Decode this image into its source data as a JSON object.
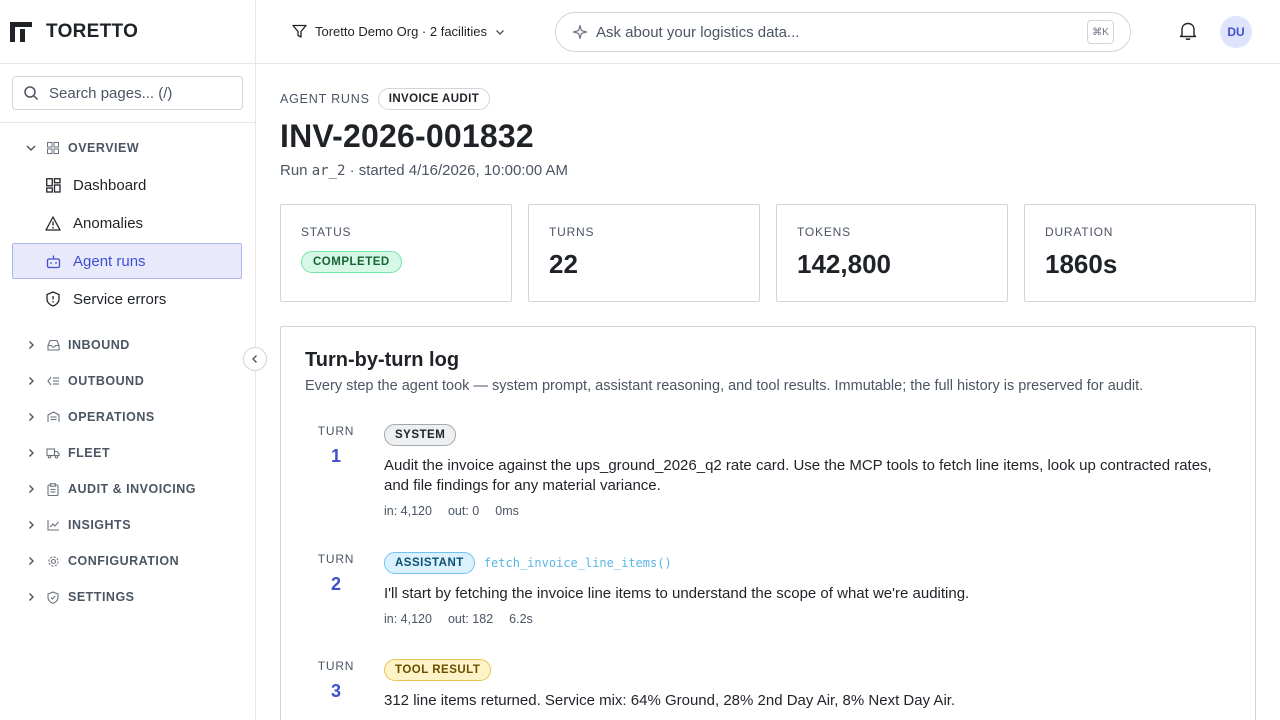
{
  "brand": {
    "name": "TORETTO"
  },
  "sidebar": {
    "search_placeholder": "Search pages...  (/)",
    "overview_group": "OVERVIEW",
    "overview_items": [
      {
        "label": "Dashboard",
        "icon": "dashboard-icon"
      },
      {
        "label": "Anomalies",
        "icon": "warning-triangle-icon"
      },
      {
        "label": "Agent runs",
        "icon": "robot-icon",
        "active": true
      },
      {
        "label": "Service errors",
        "icon": "shield-alert-icon"
      }
    ],
    "groups": [
      {
        "label": "INBOUND",
        "icon": "inbox-icon"
      },
      {
        "label": "OUTBOUND",
        "icon": "outbound-icon"
      },
      {
        "label": "OPERATIONS",
        "icon": "warehouse-icon"
      },
      {
        "label": "FLEET",
        "icon": "truck-icon"
      },
      {
        "label": "AUDIT & INVOICING",
        "icon": "clipboard-icon"
      },
      {
        "label": "INSIGHTS",
        "icon": "line-chart-icon"
      },
      {
        "label": "CONFIGURATION",
        "icon": "gear-icon"
      },
      {
        "label": "SETTINGS",
        "icon": "shield-check-icon"
      }
    ]
  },
  "topbar": {
    "org": "Toretto Demo Org · 2 facilities",
    "ask_placeholder": "Ask about your logistics data...",
    "shortcut": "⌘K",
    "avatar": "DU"
  },
  "header": {
    "crumb": "AGENT RUNS",
    "badge": "INVOICE AUDIT",
    "title": "INV-2026-001832",
    "subtitle_prefix": "Run ",
    "run_id": "ar_2",
    "subtitle_suffix": " · started 4/16/2026, 10:00:00 AM"
  },
  "stats": {
    "status_label": "STATUS",
    "status_value": "COMPLETED",
    "turns_label": "TURNS",
    "turns_value": "22",
    "tokens_label": "TOKENS",
    "tokens_value": "142,800",
    "duration_label": "DURATION",
    "duration_value": "1860s"
  },
  "log": {
    "title": "Turn-by-turn log",
    "description": "Every step the agent took — system prompt, assistant reasoning, and tool results. Immutable; the full history is preserved for audit.",
    "turn_label": "TURN",
    "turns": [
      {
        "number": "1",
        "role": "SYSTEM",
        "text": "Audit the invoice against the ups_ground_2026_q2 rate card. Use the MCP tools to fetch line items, look up contracted rates, and file findings for any material variance.",
        "tokens_in": "in: 4,120",
        "tokens_out": "out: 0",
        "duration": "0ms"
      },
      {
        "number": "2",
        "role": "ASSISTANT",
        "tool_call": "fetch_invoice_line_items()",
        "text": "I'll start by fetching the invoice line items to understand the scope of what we're auditing.",
        "tokens_in": "in: 4,120",
        "tokens_out": "out: 182",
        "duration": "6.2s"
      },
      {
        "number": "3",
        "role": "TOOL RESULT",
        "text": "312 line items returned. Service mix: 64% Ground, 28% 2nd Day Air, 8% Next Day Air."
      }
    ]
  }
}
